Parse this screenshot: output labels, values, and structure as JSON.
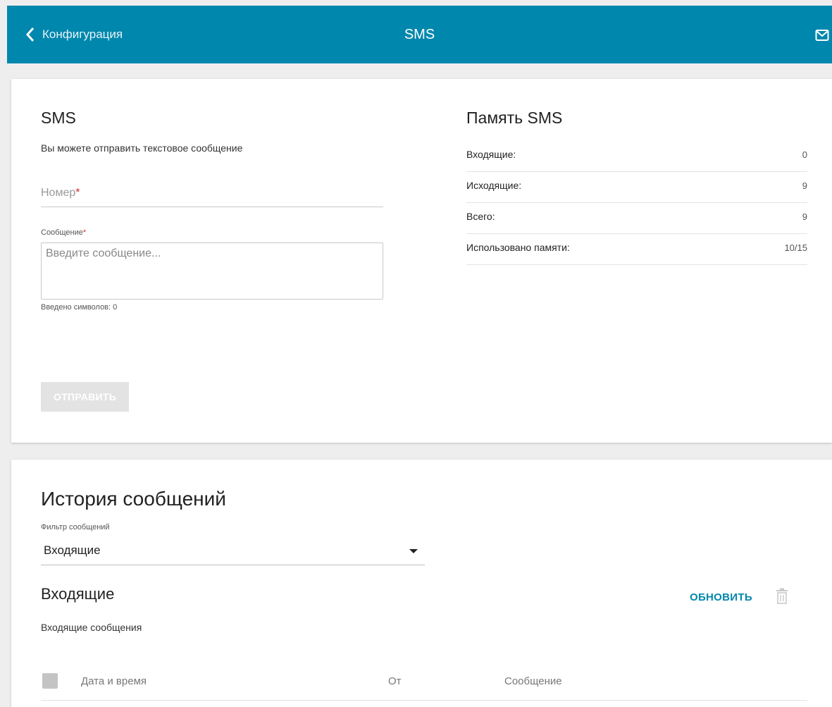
{
  "header": {
    "back_label": "Конфигурация",
    "title": "SMS",
    "mail_icon": "mail-icon"
  },
  "send": {
    "title": "SMS",
    "description": "Вы можете отправить текстовое сообщение",
    "number_placeholder": "Номер",
    "required_mark": "*",
    "message_label": "Сообщение",
    "message_placeholder": "Введите сообщение...",
    "char_count": "Введено символов: 0",
    "send_button": "ОТПРАВИТЬ"
  },
  "memory": {
    "title": "Память SMS",
    "rows": [
      {
        "label": "Входящие:",
        "value": "0"
      },
      {
        "label": "Исходящие:",
        "value": "9"
      },
      {
        "label": "Всего:",
        "value": "9"
      },
      {
        "label": "Использовано памяти:",
        "value": "10/15"
      }
    ]
  },
  "history": {
    "title": "История сообщений",
    "filter_label": "Фильтр сообщений",
    "filter_value": "Входящие",
    "section_title": "Входящие",
    "refresh_button": "ОБНОВИТЬ",
    "subtitle": "Входящие сообщения",
    "columns": [
      "Дата и время",
      "От",
      "Сообщение"
    ]
  },
  "colors": {
    "accent": "#0087ad",
    "required": "#d32f2f"
  }
}
